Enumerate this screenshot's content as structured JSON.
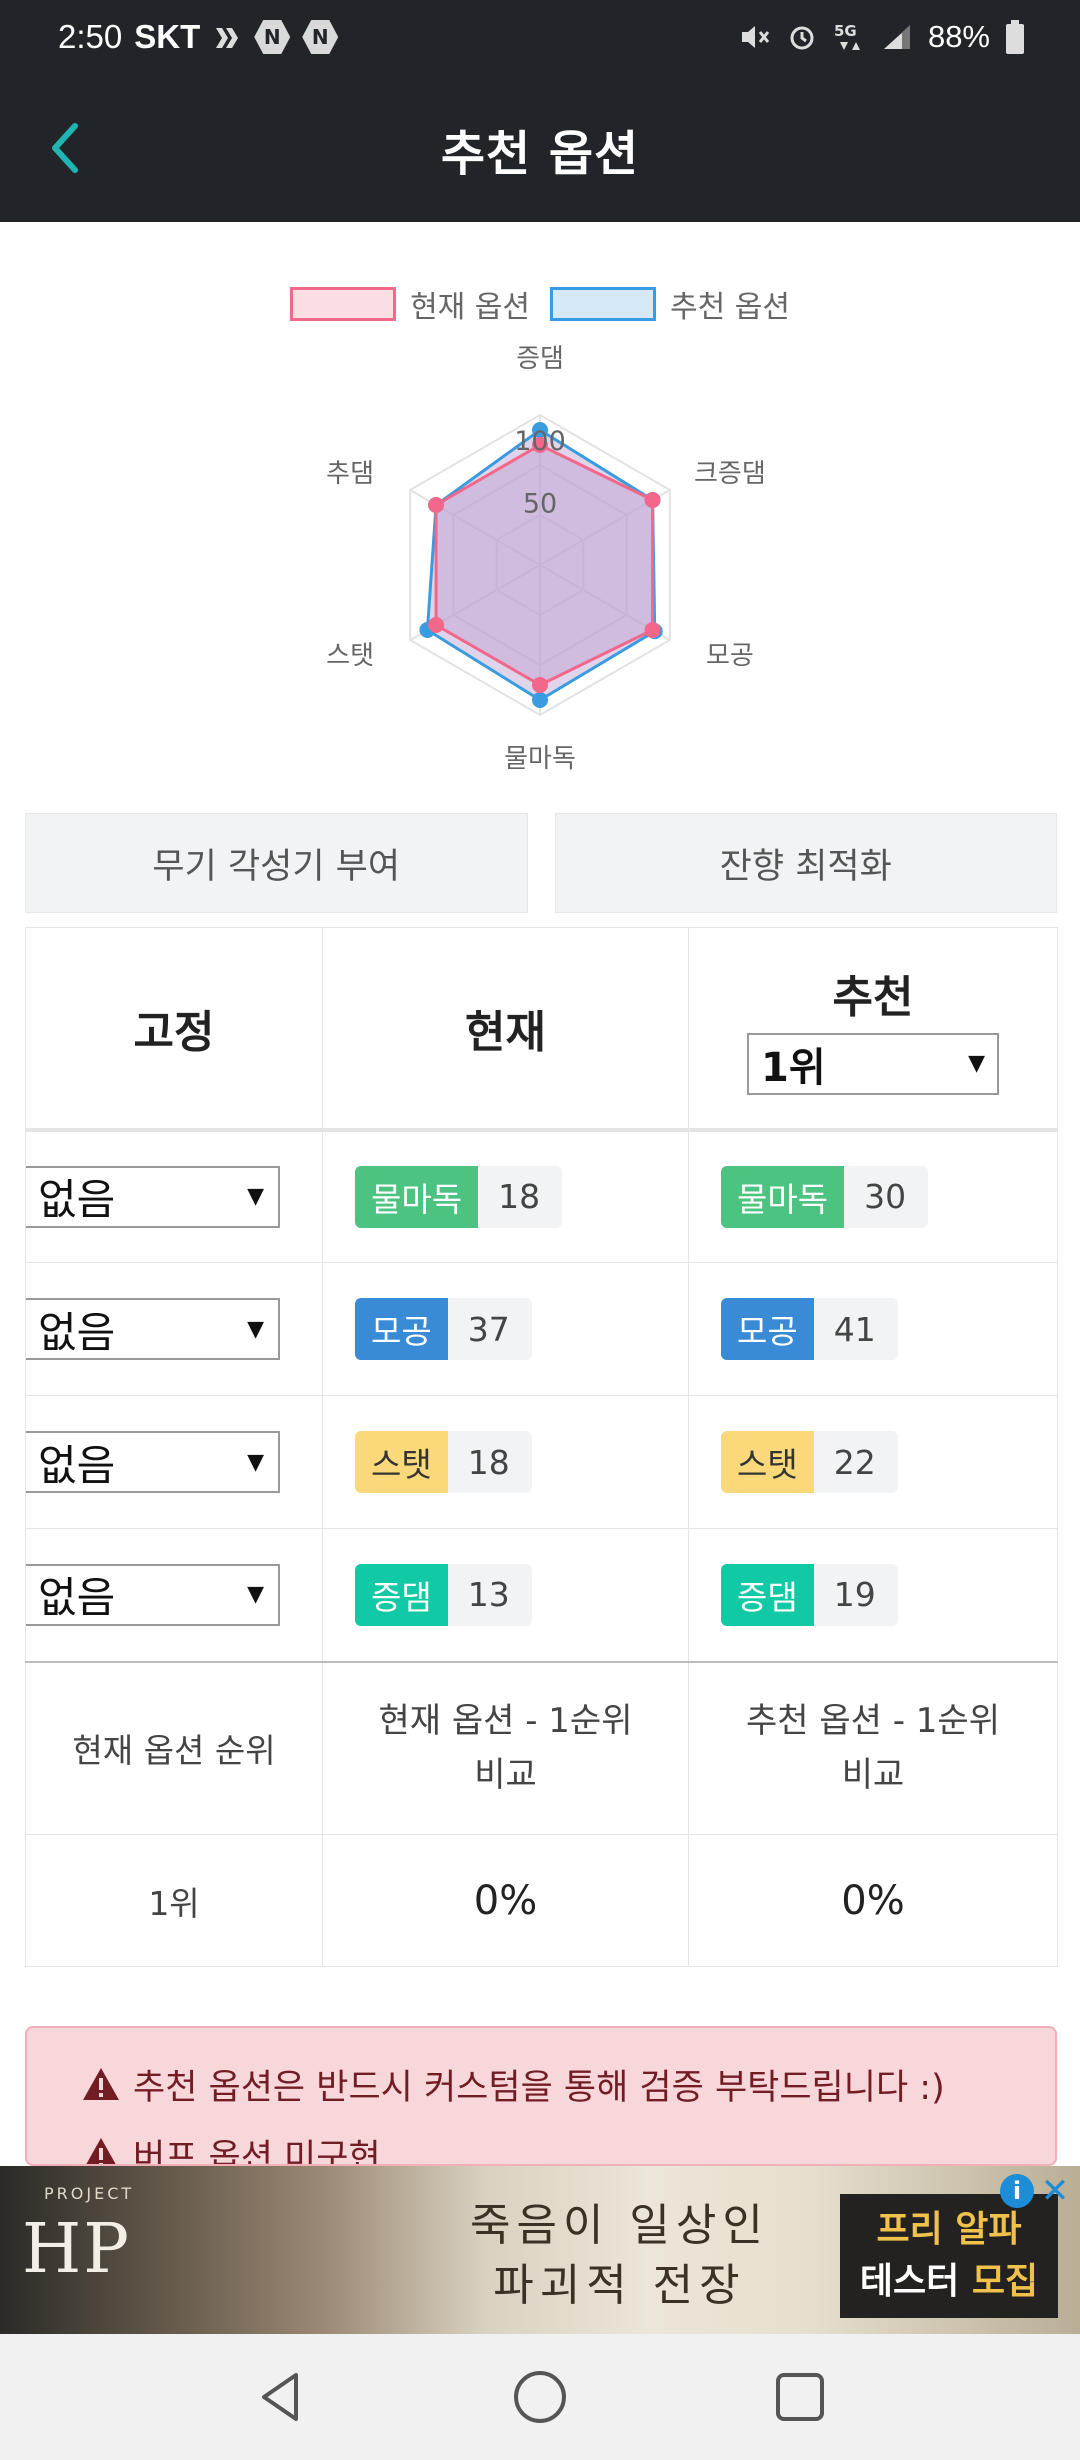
{
  "status_bar": {
    "time": "2:50",
    "carrier": "SKT",
    "battery": "88%",
    "network": "5G",
    "icons": [
      "vpn-key-icon",
      "naver-icon",
      "naver-icon",
      "mute-icon",
      "alarm-icon",
      "5g-icon",
      "signal-icon",
      "battery-icon"
    ],
    "hex_label": "N"
  },
  "header": {
    "title": "추천 옵션",
    "back_icon": "chevron-left-icon"
  },
  "legend": [
    {
      "label": "현재 옵션",
      "fill": "#fbdde4",
      "stroke": "#f2678a"
    },
    {
      "label": "추천 옵션",
      "fill": "#d6e9f8",
      "stroke": "#3a9ce0"
    }
  ],
  "radar": {
    "axes": [
      "증댐",
      "크증댐",
      "모공",
      "물마독",
      "스탯",
      "추댐"
    ],
    "ticks": [
      "100",
      "50"
    ],
    "max": 120,
    "current": [
      96,
      104,
      104,
      96,
      96,
      96
    ],
    "recommended": [
      108,
      104,
      106,
      108,
      104,
      96
    ],
    "colors": {
      "current": "#f2678a",
      "recommended": "#3a9ce0",
      "overlap": "rgba(186,160,208,0.45)"
    }
  },
  "actions": {
    "weapon_awaken": "무기 각성기 부여",
    "residual_optimize": "잔향 최적화"
  },
  "table": {
    "headers": {
      "fixed": "고정",
      "current": "현재",
      "recommended": "추천"
    },
    "rank_select": "1위",
    "fixed_value": "없음",
    "rows": [
      {
        "name": "물마독",
        "color": "#4cc381",
        "text_color": "#ffffff",
        "current": "18",
        "recommended": "30"
      },
      {
        "name": "모공",
        "color": "#3a8bd6",
        "text_color": "#ffffff",
        "current": "37",
        "recommended": "41"
      },
      {
        "name": "스탯",
        "color": "#fbd97a",
        "text_color": "#333333",
        "current": "18",
        "recommended": "22"
      },
      {
        "name": "증댐",
        "color": "#12c9a6",
        "text_color": "#ffffff",
        "current": "13",
        "recommended": "19"
      }
    ],
    "summary": {
      "rank_label": "현재 옵션 순위",
      "current_compare": [
        "현재 옵션 - 1순위",
        "비교"
      ],
      "recommended_compare": [
        "추천 옵션 - 1순위",
        "비교"
      ],
      "rank_value": "1위",
      "current_pct": "0%",
      "recommended_pct": "0%"
    }
  },
  "alert": {
    "line1": "추천 옵션은 반드시 커스텀을 통해 검증 부탁드립니다 :)",
    "line2": "버프 옵션 미구현",
    "icon": "warning-icon"
  },
  "ad": {
    "logo": "HP",
    "logo_small": "PROJECT",
    "copy_line1": "죽음이 일상인",
    "copy_line2": "파괴적 전장",
    "cta_line1": "프리 알파",
    "cta_line2a": "테스터",
    "cta_line2b": " 모집",
    "info_label": "i",
    "close_label": "✕"
  },
  "nav": {
    "back_icon": "back-triangle-icon",
    "home_icon": "home-circle-icon",
    "recents_icon": "recents-square-icon"
  }
}
